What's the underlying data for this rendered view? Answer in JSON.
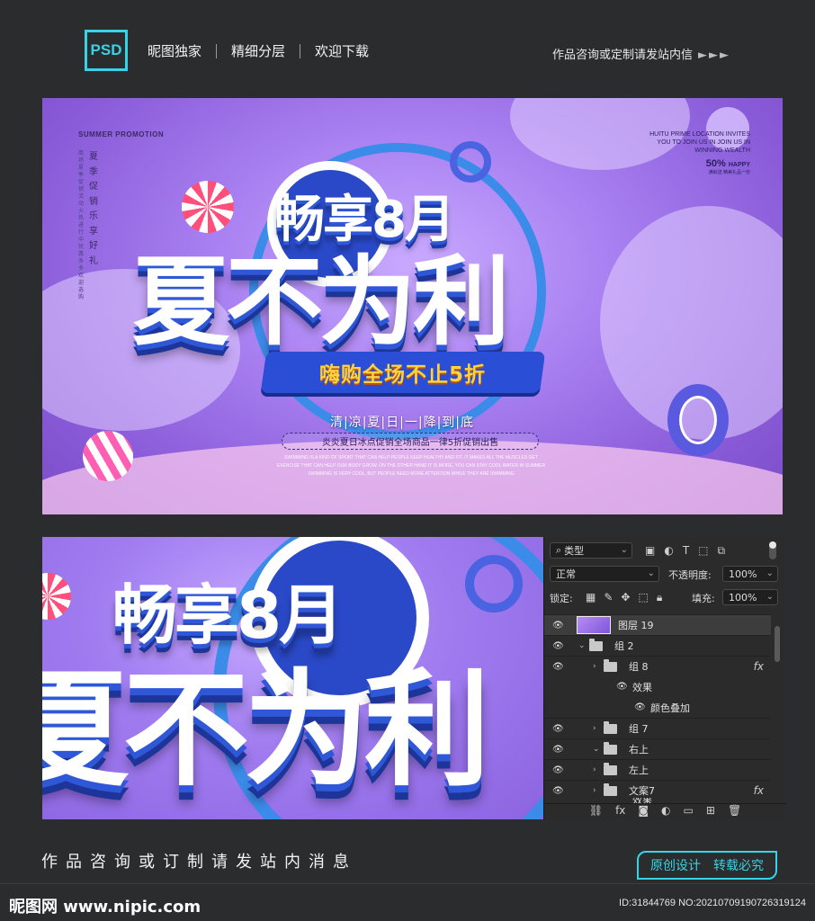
{
  "header": {
    "logo": "PSD",
    "nav": [
      "昵图独家",
      "精细分层",
      "欢迎下载"
    ],
    "contact": "作品咨询或定制请发站内信",
    "arrows": "►►►"
  },
  "banner": {
    "promo_title": "SUMMER PROMOTION",
    "vertical_text": "夏季促销乐享好礼",
    "vertical_small": "商场夏季促销活动火热进行中优惠多多欢迎选购",
    "right_lines": [
      "HUITU PRIME LOCATION INVITES",
      "YOU TO JOIN US IN JOIN US IN",
      "WINNING WEALTH"
    ],
    "right_pct": "50%",
    "right_pct_word": "HAPPY",
    "right_small": "满就送 精美礼品一份",
    "title_top": "畅享8月",
    "title_main": "夏不为利",
    "ribbon": "嗨购全场不止5折",
    "tagline": "清|凉|夏|日|一|降|到|底",
    "subtitle": "炎炎夏日冰点促销全场商品一律5折促销出售",
    "fine_print": [
      "SWIMMING IS A KIND OF SPORT THAT CAN HELP PEOPLE KEEP HEALTHY AND FIT, IT MAKES ALL THE MUSCLES GET",
      "EXERCISE THAT CAN HELP OUR BODY GROW. ON THE OTHER HAND IT IS MORE, YOU CAN STAY COOL WATER IN SUMMER",
      "SWIMMING IS VERY COOL, BUT PEOPLE NEED MORE ATTENTION WHILE THEY ARE SWIMMING"
    ]
  },
  "panel": {
    "filter_kind": "类型",
    "blend_mode": "正常",
    "opacity_label": "不透明度:",
    "opacity_value": "100%",
    "lock_label": "锁定:",
    "fill_label": "填充:",
    "fill_value": "100%",
    "layers": [
      {
        "name": "图层 19",
        "type": "image",
        "indent": 0,
        "visible": true,
        "selected": true
      },
      {
        "name": "组 2",
        "type": "group",
        "indent": 0,
        "visible": true,
        "expanded": true
      },
      {
        "name": "组 8",
        "type": "group",
        "indent": 1,
        "visible": true,
        "fx": true
      },
      {
        "name": "效果",
        "type": "effect",
        "indent": 2,
        "visible": true
      },
      {
        "name": "颜色叠加",
        "type": "effect",
        "indent": 3,
        "visible": true
      },
      {
        "name": "组 7",
        "type": "group",
        "indent": 1,
        "visible": true
      },
      {
        "name": "右上",
        "type": "group",
        "indent": 1,
        "visible": true,
        "expanded": true
      },
      {
        "name": "左上",
        "type": "group",
        "indent": 1,
        "visible": true
      },
      {
        "name": "文案7",
        "type": "group",
        "indent": 1,
        "visible": true,
        "fx": true
      },
      {
        "name": "效果",
        "type": "effect",
        "indent": 2,
        "visible": true
      }
    ],
    "fx_label": "fx"
  },
  "footer": {
    "text": "作品咨询或订制请发站内消息",
    "badge_left": "原创设计",
    "badge_right": "转载必究",
    "site": "昵图网 www.nipic.com",
    "id_line": "ID:31844769 NO:20210709190726319124"
  },
  "colors": {
    "accent": "#37d3e6",
    "page_bg": "#2b2c2e",
    "banner_purple": "#a77ef0",
    "title_blue": "#2f58d9",
    "ribbon_text": "#ffd23a"
  }
}
